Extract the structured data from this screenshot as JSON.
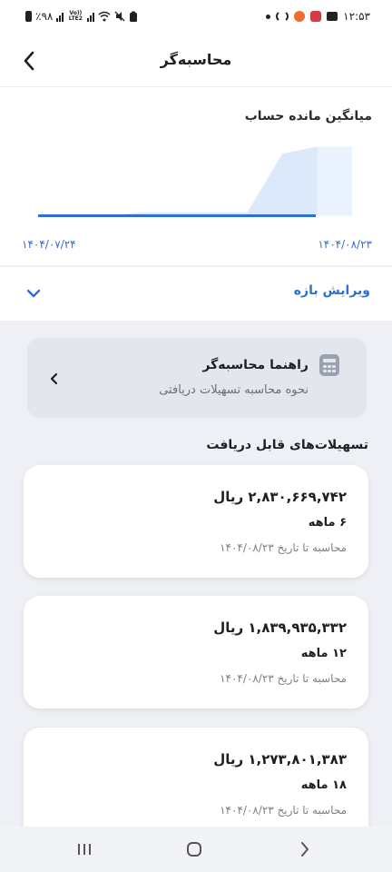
{
  "status_bar": {
    "time": "۱۲:۵۳",
    "battery": "٪۹۸",
    "network": "Vo)) LTE2"
  },
  "header": {
    "title": "محاسبه‌گر",
    "back_icon": "chevron-left-icon"
  },
  "balance_chart": {
    "title": "میانگین مانده حساب",
    "start_date": "۱۴۰۴/۰۷/۲۴",
    "end_date": "۱۴۰۴/۰۸/۲۳",
    "line_color": "#2d6fd6",
    "area_color": "#dbe9fb"
  },
  "chart_data": {
    "type": "area",
    "title": "میانگین مانده حساب",
    "x_labels": [
      "۱۴۰۴/۰۷/۲۴",
      "۱۴۰۴/۰۸/۲۳"
    ],
    "series": [
      {
        "values": [
          0,
          0,
          0,
          0.05,
          0.05,
          0.05,
          0.05,
          0.9,
          1.0,
          1.0
        ]
      }
    ],
    "grid": false
  },
  "range": {
    "label": "ویرایش بازه",
    "icon": "chevron-down-icon"
  },
  "guide": {
    "title": "راهنما محاسبه‌گر",
    "subtitle": "نحوه محاسبه تسهیلات دریافتی",
    "icon": "calculator-icon"
  },
  "loans_section": {
    "title": "تسهیلات‌های قابل دریافت"
  },
  "loans": [
    {
      "amount": "۲,۸۳۰,۶۶۹,۷۴۲ ریال",
      "term": "۶ ماهه",
      "note": "محاسبه تا تاریخ ۱۴۰۴/۰۸/۲۳"
    },
    {
      "amount": "۱,۸۳۹,۹۳۵,۳۳۲ ریال",
      "term": "۱۲ ماهه",
      "note": "محاسبه تا تاریخ ۱۴۰۴/۰۸/۲۳"
    },
    {
      "amount": "۱,۲۷۳,۸۰۱,۳۸۳ ریال",
      "term": "۱۸ ماهه",
      "note": "محاسبه تا تاریخ ۱۴۰۴/۰۸/۲۳"
    }
  ],
  "nav_bar": {
    "recents_icon": "recents-icon",
    "home_icon": "home-icon",
    "back_icon": "back-chevron-icon"
  }
}
